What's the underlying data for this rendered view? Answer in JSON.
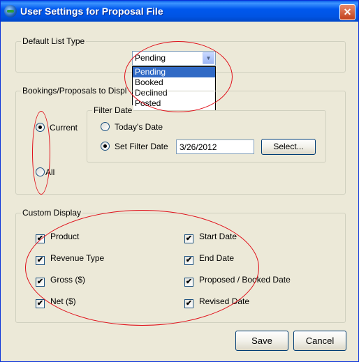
{
  "window": {
    "title": "User Settings for Proposal File",
    "close_glyph": "✕"
  },
  "default_list": {
    "legend": "Default List Type",
    "combo_value": "Pending",
    "combo_arrow": "▼",
    "options": [
      "Pending",
      "Booked",
      "Declined",
      "Posted"
    ],
    "selected_option": "Pending"
  },
  "bookings": {
    "legend": "Bookings/Proposals to Displ",
    "current_label": "Current",
    "all_label": "All",
    "current_selected": true
  },
  "filter_date": {
    "legend": "Filter Date",
    "today_label": "Today's Date",
    "set_label": "Set Filter Date",
    "date_value": "3/26/2012",
    "select_button": "Select...",
    "set_selected": true
  },
  "custom_display": {
    "legend": "Custom Display",
    "left": [
      {
        "label": "Product",
        "checked": true
      },
      {
        "label": "Revenue Type",
        "checked": true
      },
      {
        "label": "Gross ($)",
        "checked": true
      },
      {
        "label": "Net ($)",
        "checked": true
      }
    ],
    "right": [
      {
        "label": "Start Date",
        "checked": true
      },
      {
        "label": "End Date",
        "checked": true
      },
      {
        "label": "Proposed / Booked Date",
        "checked": true
      },
      {
        "label": "Revised Date",
        "checked": true
      }
    ],
    "check_glyph": "✔"
  },
  "buttons": {
    "save": "Save",
    "cancel": "Cancel"
  },
  "colors": {
    "title_bar": "#0054e3",
    "annotation": "#e0101a",
    "selection": "#316ac5"
  }
}
